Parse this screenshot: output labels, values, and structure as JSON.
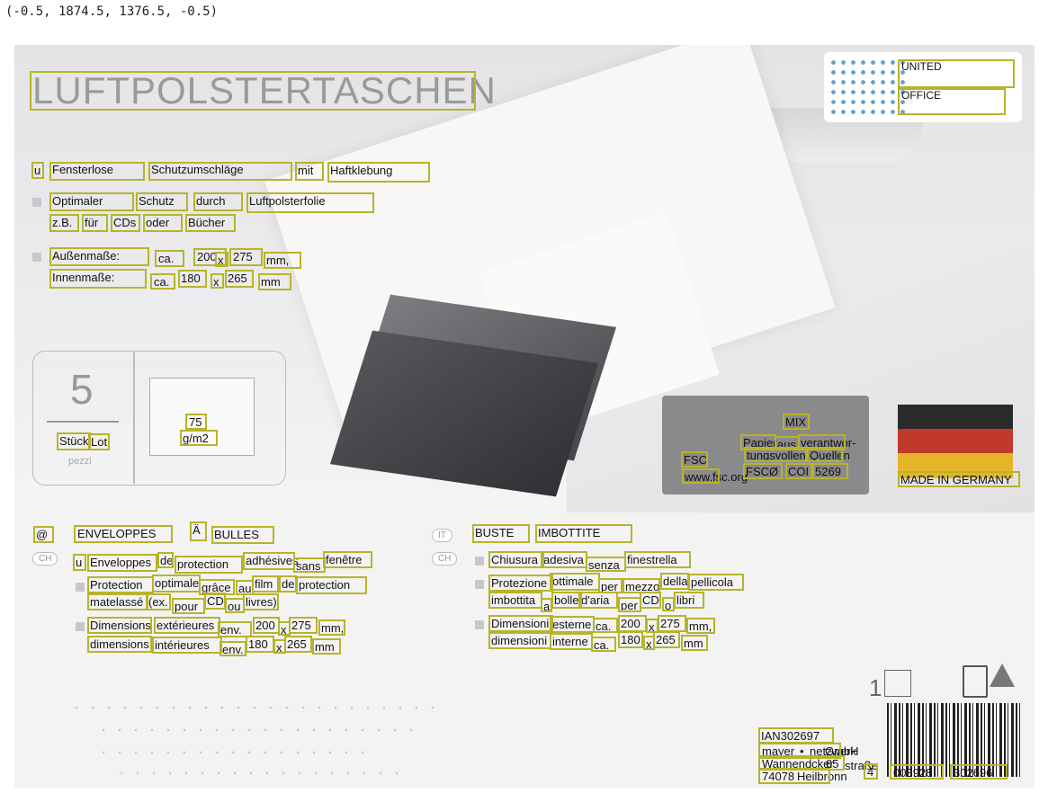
{
  "header_coords": "(-0.5, 1874.5, 1376.5, -0.5)",
  "title": "LUFTPOLSTERTASCHEN",
  "logo": {
    "line1": "UNITED",
    "line2": "OFFICE"
  },
  "de": {
    "b1": [
      "u",
      "Fensterlose",
      "Schutzumschläge",
      "mit",
      "Haftklebung"
    ],
    "b2_l1": [
      "Optimaler",
      "Schutz",
      "durch",
      "Luftpolsterfolie"
    ],
    "b2_l2": [
      "z.B.",
      "für",
      "CDs",
      "oder",
      "Bücher"
    ],
    "b3_l1": [
      "Außenmaße:",
      "ca.",
      "200",
      "x",
      "275",
      "mm,"
    ],
    "b3_l2": [
      "Innenmaße:",
      "ca.",
      "180",
      "x",
      "265",
      "mm"
    ]
  },
  "qty": {
    "count": "5",
    "word1": "Stück",
    "word2": "Lot,",
    "word3": "pezzi"
  },
  "paper": {
    "weight": "75",
    "unit": "g/m2"
  },
  "fsc": {
    "mix": "MIX",
    "l1a": "Papier",
    "l1b": "aus",
    "l1c": "verantwor-",
    "l2a": "tungsvollen",
    "l2b": "Quellen",
    "label": "FSC",
    "url": "www.fsc.org",
    "code1": "FSCØ",
    "code2": "COI",
    "code3": "5269"
  },
  "made_in": "MADE IN GERMANY",
  "fr": {
    "badge1": "@",
    "badge2": "CH",
    "title": [
      "ENVELOPPES",
      "Ä",
      "BULLES"
    ],
    "l1": [
      "u",
      "Enveloppes",
      "de",
      "protection",
      "adhésives",
      "sans",
      "fenêtre"
    ],
    "l2": [
      "Protection",
      "optimale",
      "grâce",
      "au",
      "film",
      "de",
      "protection"
    ],
    "l3": [
      "matelassé",
      "(ex.",
      "pour",
      "CD",
      "ou",
      "livres)"
    ],
    "l4": [
      "Dimensions",
      "extérieures",
      "env.",
      "200",
      "x",
      "275",
      "mm,"
    ],
    "l5": [
      "dimensions",
      "intérieures",
      "env.",
      "180",
      "x",
      "265",
      "mm"
    ]
  },
  "it": {
    "badge1": "IT",
    "badge2": "CH",
    "title": [
      "BUSTE",
      "IMBOTTITE"
    ],
    "l1": [
      "Chiusura",
      "adesiva",
      "senza",
      "finestrella"
    ],
    "l2": [
      "Protezione",
      "ottimale",
      "per",
      "mezzo",
      "della",
      "pellicola"
    ],
    "l3": [
      "imbottita",
      "a",
      "bolle",
      "d'aria",
      "per",
      "CD",
      "o",
      "libri"
    ],
    "l4": [
      "Dimensioni",
      "esterne",
      "ca.",
      "200",
      "x",
      "275",
      "mm,"
    ],
    "l5": [
      "dimensioni",
      "interne",
      "ca.",
      "180",
      "x",
      "265",
      "mm"
    ]
  },
  "bottom": {
    "count_box": "1",
    "ian": "IAN302697",
    "company": [
      "mayer",
      "•",
      "netzwerk",
      "GmbH"
    ],
    "street": [
      "Wannendcker",
      "straße",
      "65"
    ],
    "city": [
      "74078",
      "Heilbronn"
    ],
    "barcode_digits": [
      "4",
      "003928",
      "302696"
    ]
  }
}
